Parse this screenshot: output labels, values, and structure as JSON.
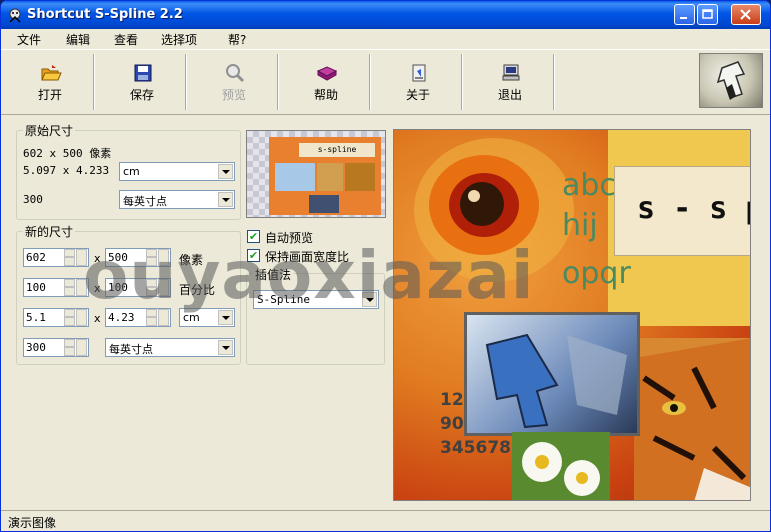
{
  "window": {
    "title": "Shortcut S-Spline 2.2"
  },
  "menu": [
    "文件",
    "编辑",
    "查看",
    "选择项",
    "帮?"
  ],
  "toolbar": {
    "open": "打开",
    "save": "保存",
    "preview": "预览",
    "help": "帮助",
    "about": "关于",
    "exit": "退出"
  },
  "original": {
    "legend": "原始尺寸",
    "pixels": "602 x 500 像素",
    "size": "5.097 x 4.233",
    "size_unit": "cm",
    "dpi": "300",
    "dpi_unit": "每英寸点"
  },
  "newsize": {
    "legend": "新的尺寸",
    "x": "x",
    "width_px": "602",
    "height_px": "500",
    "px_label": "像素",
    "width_pct": "100",
    "height_pct": "100",
    "pct_label": "百分比",
    "width_cm": "5.1",
    "height_cm": "4.23",
    "cm_unit": "cm",
    "dpi": "300",
    "dpi_unit": "每英寸点"
  },
  "options": {
    "auto_preview": "自动预览",
    "keep_ratio": "保持画面宽度比",
    "interp_legend": "插值法",
    "interp_value": "S-Spline"
  },
  "thumbnail": {
    "logo_text": "s-spline"
  },
  "preview": {
    "letters": [
      "abc",
      "hij",
      "opqr"
    ],
    "banner": "s - s p",
    "numbers": [
      "12",
      "90",
      "345678"
    ]
  },
  "watermark": "ouyaoxiazai",
  "status": "演示图像"
}
